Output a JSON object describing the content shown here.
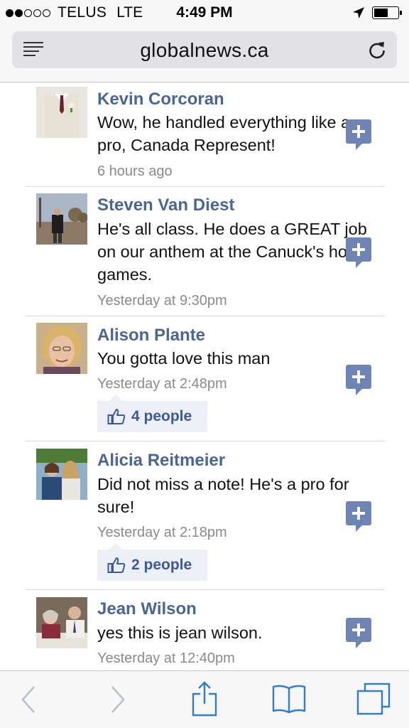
{
  "status_bar": {
    "signal_bars_full": 2,
    "signal_bars_total": 5,
    "carrier": "TELUS",
    "network": "LTE",
    "time": "4:49 PM",
    "location_icon": "location-arrow-icon",
    "battery_icon": "battery-icon",
    "battery_level": 0.6
  },
  "browser": {
    "url": "globalnews.ca",
    "reader_icon": "reader-list-icon",
    "reload_icon": "reload-icon"
  },
  "comments": [
    {
      "name": "Kevin Corcoran",
      "text": "Wow, he handled everything like a pro, Canada Represent!",
      "time": "6 hours ago",
      "likes": null
    },
    {
      "name": "Steven Van Diest",
      "text": "He's all class. He does a GREAT job on our anthem at the Canuck's home games.",
      "time": "Yesterday at 9:30pm",
      "likes": null
    },
    {
      "name": "Alison Plante",
      "text": "You gotta love this man",
      "time": "Yesterday at 2:48pm",
      "likes": "4 people"
    },
    {
      "name": "Alicia Reitmeier",
      "text": "Did not miss a note! He's a pro for sure!",
      "time": "Yesterday at 2:18pm",
      "likes": "2 people"
    },
    {
      "name": "Jean Wilson",
      "text": "yes this is jean wilson.",
      "time": "Yesterday at 12:40pm",
      "likes": null
    }
  ],
  "toolbar": {
    "back_icon": "chevron-left-icon",
    "forward_icon": "chevron-right-icon",
    "share_icon": "share-icon",
    "bookmarks_icon": "book-icon",
    "tabs_icon": "tabs-icon"
  },
  "colors": {
    "name_blue": "#4b6595",
    "like_blue": "#3b5998",
    "ios_blue": "#2f7bd6",
    "plus_bubble": "#6d84b4"
  }
}
